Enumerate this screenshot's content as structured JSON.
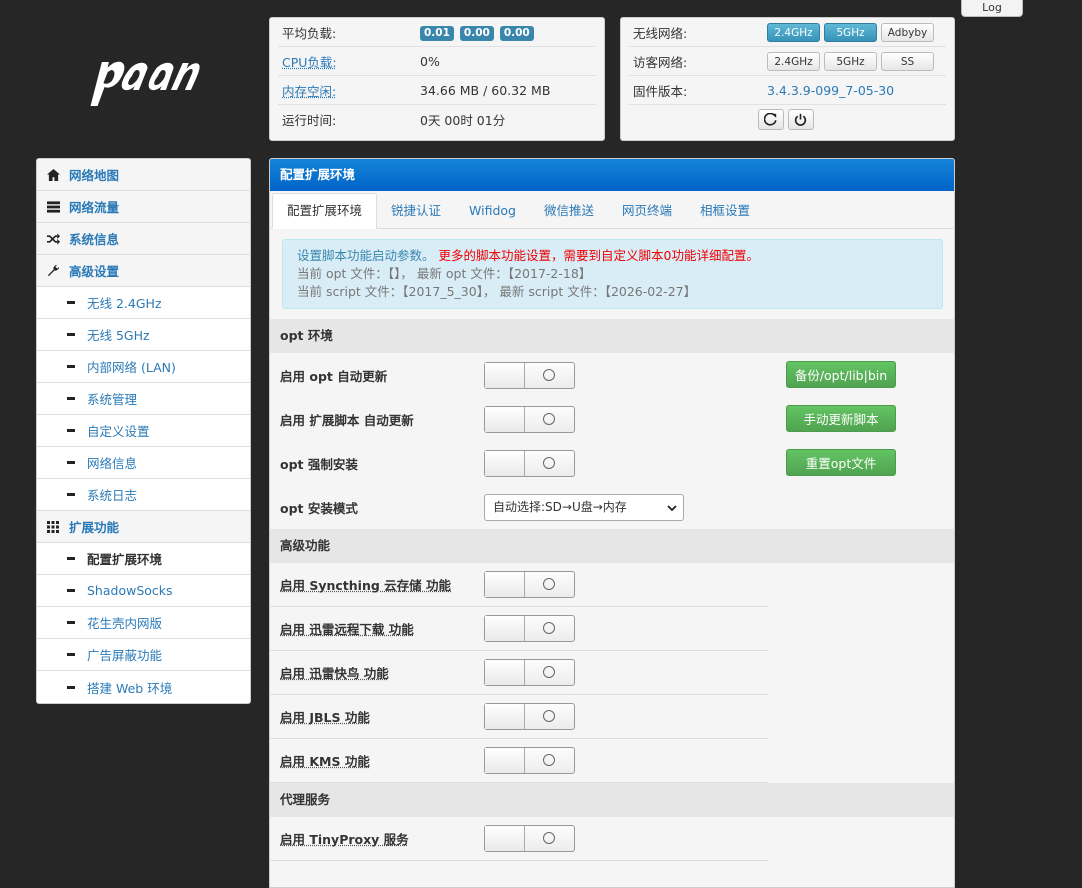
{
  "header": {
    "log_label": "Log"
  },
  "sysinfo": {
    "load_label": "平均负载:",
    "load_values": [
      "0.01",
      "0.00",
      "0.00"
    ],
    "cpu_label": "CPU负载:",
    "cpu_value": "0%",
    "mem_label": "内存空闲:",
    "mem_value": "34.66 MB / 60.32 MB",
    "uptime_label": "运行时间:",
    "uptime_value": "0天 00时 01分"
  },
  "netinfo": {
    "wifi_label": "无线网络:",
    "wifi_buttons": [
      "2.4GHz",
      "5GHz",
      "Adbyby"
    ],
    "guest_label": "访客网络:",
    "guest_buttons": [
      "2.4GHz",
      "5GHz",
      "SS"
    ],
    "fw_label": "固件版本:",
    "fw_value": "3.4.3.9-099_7-05-30",
    "icons": [
      "refresh-icon",
      "power-icon"
    ]
  },
  "sidebar": {
    "items": [
      {
        "label": "网络地图",
        "type": "head",
        "icon": "home-icon"
      },
      {
        "label": "网络流量",
        "type": "head",
        "icon": "traffic-icon"
      },
      {
        "label": "系统信息",
        "type": "head",
        "icon": "shuffle-icon"
      },
      {
        "label": "高级设置",
        "type": "head",
        "icon": "wrench-icon"
      },
      {
        "label": "无线 2.4GHz",
        "type": "sub"
      },
      {
        "label": "无线 5GHz",
        "type": "sub"
      },
      {
        "label": "内部网络 (LAN)",
        "type": "sub"
      },
      {
        "label": "系统管理",
        "type": "sub"
      },
      {
        "label": "自定义设置",
        "type": "sub"
      },
      {
        "label": "网络信息",
        "type": "sub"
      },
      {
        "label": "系统日志",
        "type": "sub"
      },
      {
        "label": "扩展功能",
        "type": "head",
        "icon": "grid-icon"
      },
      {
        "label": "配置扩展环境",
        "type": "sub",
        "active": true
      },
      {
        "label": "ShadowSocks",
        "type": "sub"
      },
      {
        "label": "花生壳内网版",
        "type": "sub"
      },
      {
        "label": "广告屏蔽功能",
        "type": "sub"
      },
      {
        "label": "搭建 Web 环境",
        "type": "sub"
      }
    ]
  },
  "main": {
    "title": "配置扩展环境",
    "tabs": [
      "配置扩展环境",
      "锐捷认证",
      "Wifidog",
      "微信推送",
      "网页终端",
      "相框设置"
    ],
    "alert": {
      "line1_a": "设置脚本功能启动参数。",
      "line1_b": "更多的脚本功能设置，需要到自定义脚本0功能详细配置。",
      "line2": "当前 opt 文件：【】， 最新 opt 文件：【2017-2-18】",
      "line3": "当前 script 文件：【2017_5_30】， 最新 script 文件：【2026-02-27】"
    },
    "opt_section": "opt 环境",
    "opt_rows": [
      {
        "label": "启用 opt 自动更新",
        "button": "备份/opt/lib|bin"
      },
      {
        "label": "启用 扩展脚本 自动更新",
        "button": "手动更新脚本"
      },
      {
        "label": "opt 强制安装",
        "button": "重置opt文件"
      }
    ],
    "opt_mode_label": "opt 安装模式",
    "opt_mode_value": "自动选择:SD→U盘→内存",
    "adv_section": "高级功能",
    "adv_rows": [
      "启用 Syncthing 云存储 功能",
      "启用 迅雷远程下载 功能",
      "启用 迅雷快鸟 功能",
      "启用 JBLS 功能",
      "启用 KMS 功能"
    ],
    "proxy_section": "代理服务",
    "proxy_rows": [
      "启用 TinyProxy 服务"
    ]
  }
}
